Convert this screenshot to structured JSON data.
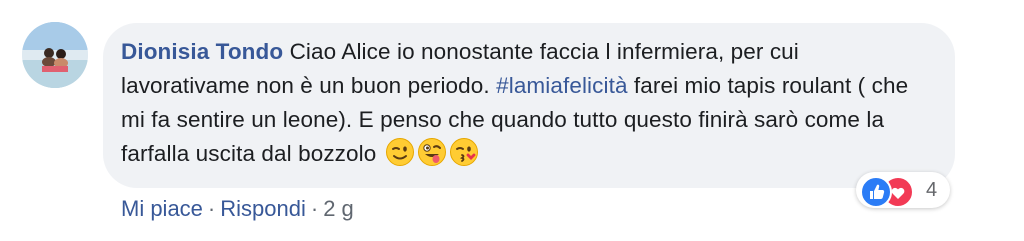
{
  "comment": {
    "author": "Dionisia Tondo",
    "text_before_hashtag": " Ciao Alice io nonostante faccia l infermiera, per cui lavorativame non è un buon periodo. ",
    "hashtag": "#lamiafelicità",
    "text_after_hashtag": " farei mio tapis roulant ( che mi fa sentire un leone). E penso che quando tutto questo finirà sarò come la farfalla uscita dal bozzolo",
    "emojis": [
      "wink-emoji",
      "zany-face-emoji",
      "kissing-wink-emoji"
    ]
  },
  "reactions": {
    "types": [
      "like-icon",
      "love-icon"
    ],
    "count": "4"
  },
  "actions": {
    "like_label": "Mi piace",
    "separator": "·",
    "reply_label": "Rispondi",
    "timestamp": "2 g"
  },
  "colors": {
    "link_blue": "#385898",
    "bubble_bg": "#f0f2f5",
    "like_blue": "#2b7cf6",
    "love_red": "#f23a55"
  }
}
